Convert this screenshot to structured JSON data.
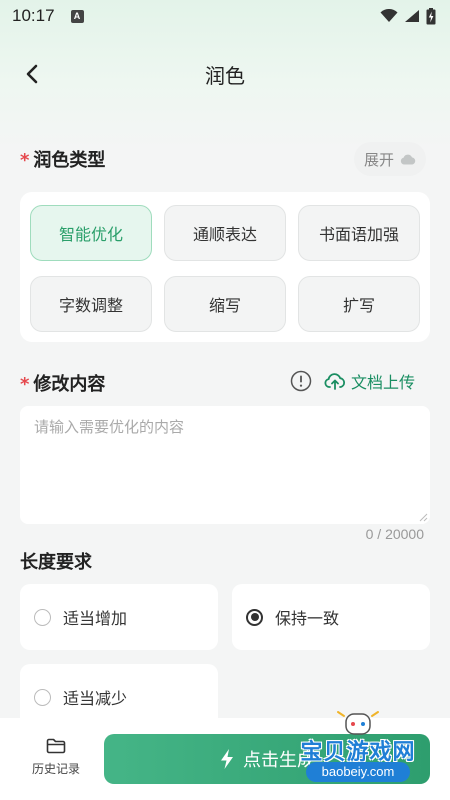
{
  "status_bar": {
    "time": "10:17",
    "notification_letter": "A"
  },
  "nav": {
    "title": "润色"
  },
  "polish_type": {
    "required_mark": "*",
    "label": "润色类型",
    "expand_label": "展开",
    "options": [
      {
        "label": "智能优化",
        "active": true
      },
      {
        "label": "通顺表达",
        "active": false
      },
      {
        "label": "书面语加强",
        "active": false
      },
      {
        "label": "字数调整",
        "active": false
      },
      {
        "label": "缩写",
        "active": false
      },
      {
        "label": "扩写",
        "active": false
      }
    ]
  },
  "content": {
    "required_mark": "*",
    "label": "修改内容",
    "upload_label": "文档上传",
    "placeholder": "请输入需要优化的内容",
    "value": "",
    "counter": "0 / 20000"
  },
  "length": {
    "label": "长度要求",
    "options": [
      {
        "label": "适当增加",
        "checked": false
      },
      {
        "label": "保持一致",
        "checked": true
      },
      {
        "label": "适当减少",
        "checked": false
      }
    ]
  },
  "bottom": {
    "history_label": "历史记录",
    "start_label": "点击生成"
  },
  "watermark": {
    "title": "宝贝游戏网",
    "url": "baobeiy.com"
  },
  "colors": {
    "accent": "#2e9e6e",
    "accent_light": "#e6f6ee",
    "required": "#e5484d"
  }
}
